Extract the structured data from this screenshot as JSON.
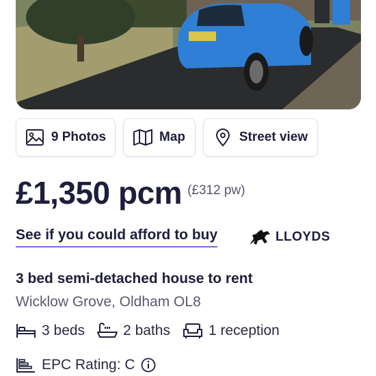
{
  "media_buttons": {
    "photos": {
      "label": "9 Photos",
      "icon": "image-icon"
    },
    "map": {
      "label": "Map",
      "icon": "map-icon"
    },
    "street_view": {
      "label": "Street view",
      "icon": "location-pin-icon"
    }
  },
  "listing": {
    "price": "£1,350 pcm",
    "price_weekly": "(£312 pw)",
    "afford_link": "See if you could afford to buy",
    "partner": "LLOYDS",
    "title": "3 bed semi-detached house to rent",
    "address": "Wicklow Grove, Oldham OL8"
  },
  "features": {
    "beds": "3 beds",
    "baths": "2 baths",
    "reception": "1 reception"
  },
  "epc": {
    "label": "EPC Rating: C"
  },
  "colors": {
    "text_dark": "#1e1e3c",
    "link_underline": "#7a6ad6",
    "car_blue": "#2f7fd6"
  }
}
